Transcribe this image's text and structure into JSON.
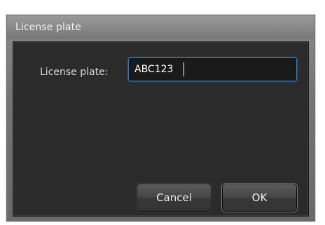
{
  "window": {
    "title": "License plate"
  },
  "form": {
    "label": "License plate:",
    "value": "ABC123"
  },
  "buttons": {
    "cancel_label": "Cancel",
    "ok_label": "OK"
  },
  "colors": {
    "focus_border": "#2f7fc4",
    "client_bg": "#2b2b2b"
  }
}
